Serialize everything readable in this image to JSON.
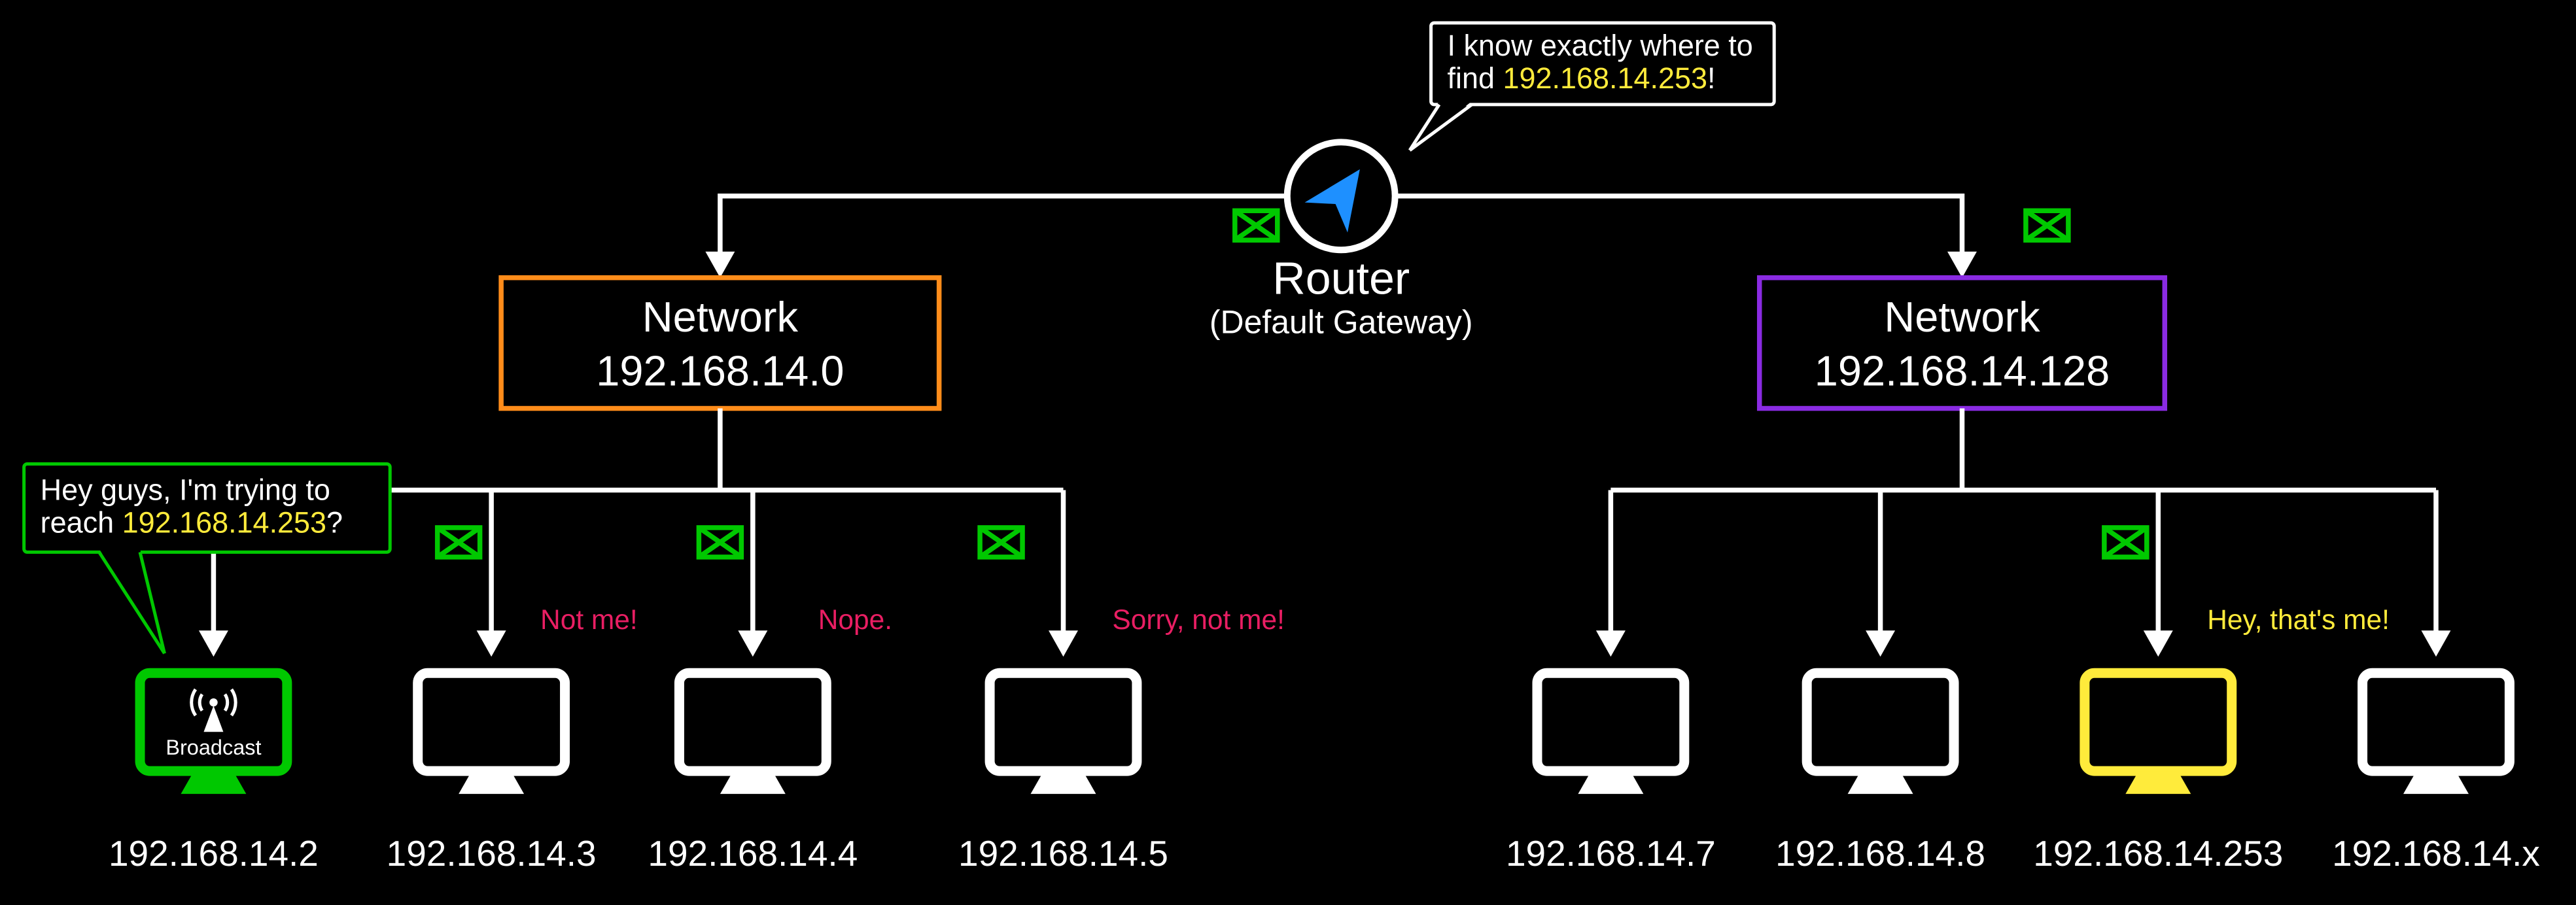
{
  "router": {
    "title": "Router",
    "subtitle": "(Default Gateway)",
    "bubble_line1_a": "I know exactly where to",
    "bubble_line2_a": "find ",
    "bubble_line2_ip": "192.168.14.253",
    "bubble_line2_b": "!"
  },
  "networks": {
    "left": {
      "label": "Network",
      "ip": "192.168.14.0",
      "border": "#ff8c1a"
    },
    "right": {
      "label": "Network",
      "ip": "192.168.14.128",
      "border": "#8a2be2"
    }
  },
  "source": {
    "ip": "192.168.14.2",
    "bubble_line1": "Hey guys, I'm trying to",
    "bubble_line2_a": "reach ",
    "bubble_line2_ip": "192.168.14.253",
    "bubble_line2_b": "?",
    "broadcast_label": "Broadcast",
    "border": "#00c800"
  },
  "hosts_left": [
    {
      "ip": "192.168.14.3",
      "response": "Not me!"
    },
    {
      "ip": "192.168.14.4",
      "response": "Nope."
    },
    {
      "ip": "192.168.14.5",
      "response": "Sorry, not me!"
    }
  ],
  "hosts_right": [
    {
      "ip": "192.168.14.7"
    },
    {
      "ip": "192.168.14.8"
    },
    {
      "ip": "192.168.14.253",
      "response": "Hey, that's me!",
      "highlight": "#ffeb3b"
    },
    {
      "ip": "192.168.14.x"
    }
  ],
  "colors": {
    "envelope_stroke": "#00c800",
    "router_arrow": "#1e90ff"
  }
}
